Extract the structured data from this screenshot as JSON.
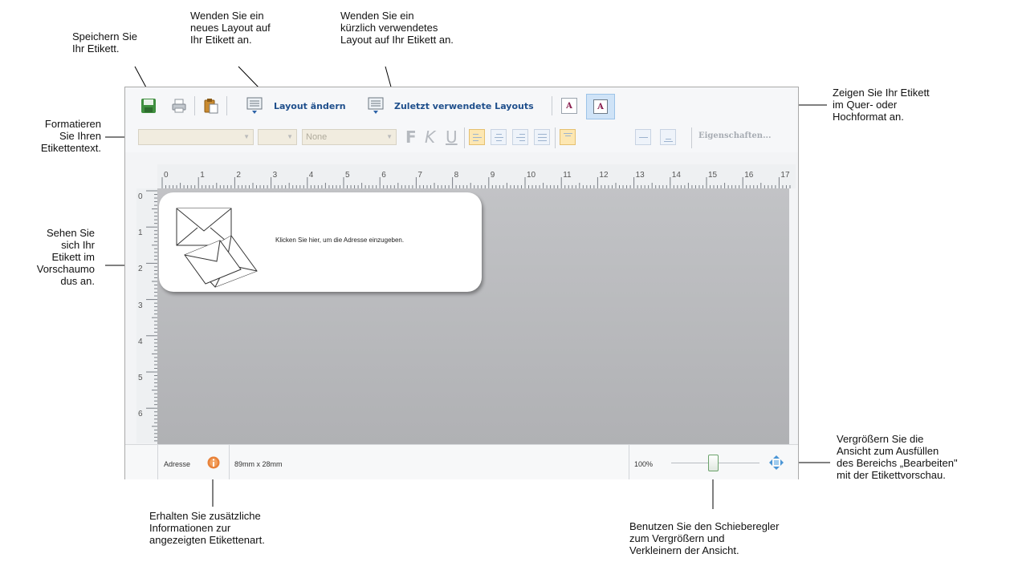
{
  "callouts": {
    "save": "Speichern Sie\nIhr Etikett.",
    "layout": "Wenden Sie ein\nneues Layout auf\nIhr Etikett an.",
    "recent": "Wenden Sie ein\nkürzlich verwendetes\nLayout auf Ihr Etikett an.",
    "orientation": "Zeigen Sie Ihr Etikett\nim Quer- oder\nHochformat an.",
    "format": "Formatieren\nSie Ihren\nEtikettentext.",
    "preview": "Sehen Sie\nsich Ihr\nEtikett im\nVorschaumo\ndus an.",
    "fit": "Vergrößern Sie die\nAnsicht zum Ausfüllen\ndes Bereichs „Bearbeiten\"\nmit der Etikettvorschau.",
    "info": "Erhalten Sie zusätzliche\nInformationen zur\nangezeigten Etikettenart.",
    "slider": "Benutzen Sie den Schieberegler\nzum Vergrößern und\nVerkleinern der Ansicht."
  },
  "toolbar": {
    "layout_label": "Layout ändern",
    "recent_label": "Zuletzt verwendete Layouts",
    "orientation_glyph": "A"
  },
  "format_bar": {
    "font_name": "",
    "font_size": "",
    "style_value": "None",
    "bold": "F",
    "italic": "K",
    "underline": "U",
    "properties_label": "Eigenschaften..."
  },
  "ruler": {
    "horizontal": [
      "0",
      "1",
      "2",
      "3",
      "4",
      "5",
      "6",
      "7",
      "8",
      "9",
      "10",
      "11",
      "12",
      "13",
      "14",
      "15",
      "16",
      "17"
    ],
    "vertical": [
      "0",
      "1",
      "2",
      "3",
      "4",
      "5",
      "6"
    ]
  },
  "label": {
    "text": "Klicken Sie hier, um die Adresse einzugeben."
  },
  "status": {
    "label_type": "Adresse",
    "dimensions": "89mm x 28mm",
    "zoom": "100%"
  },
  "colors": {
    "accent_link": "#1f4f8c",
    "info_icon": "#e8823a",
    "canvas_gray": "#b7b8bb",
    "active_button": "#cfe3f7"
  }
}
